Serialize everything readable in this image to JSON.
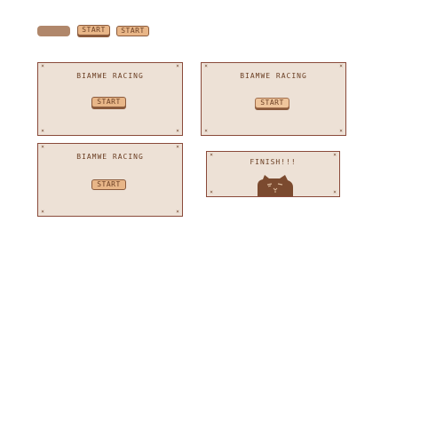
{
  "colors": {
    "panel_bg": "#ede1d6",
    "panel_border": "#8a4a3a",
    "text": "#6b3f24",
    "button_fill": "#e8b688",
    "button_plain": "#b0876b",
    "cat": "#7b4a2f"
  },
  "top_buttons": {
    "start_raised": "START",
    "start_flat": "START"
  },
  "panels": [
    {
      "title": "BIAMWE RACING",
      "button": "START"
    },
    {
      "title": "BIAMWE RACING",
      "button": "START"
    },
    {
      "title": "BIAMWE RACING",
      "button": "START"
    }
  ],
  "finish_panel": {
    "title": "FINISH!!!",
    "icon": "cat-face-icon"
  },
  "corner_glyph": "×"
}
